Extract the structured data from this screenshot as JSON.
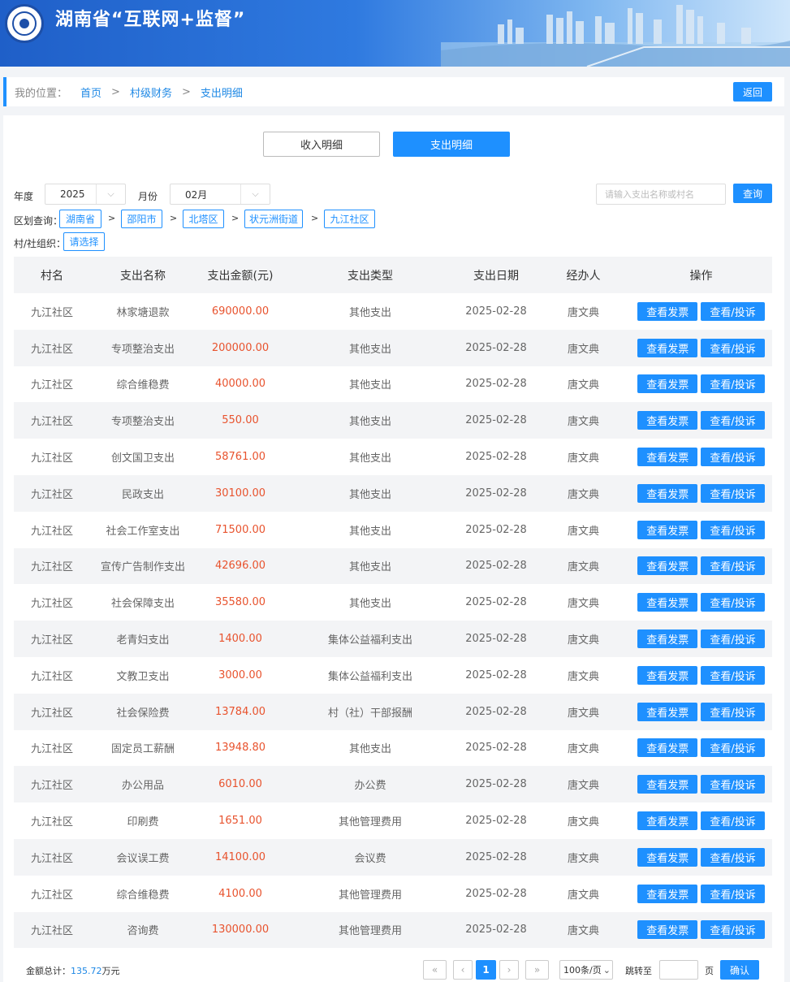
{
  "header": {
    "title": "湖南省“互联网+监督”",
    "logo_icon": "eye-seal-icon"
  },
  "breadcrumb": {
    "label": "我的位置：",
    "items": [
      "首页",
      "村级财务",
      "支出明细"
    ],
    "separator": ">",
    "back_label": "返回"
  },
  "tabs": {
    "income": "收入明细",
    "expense": "支出明细",
    "active": "expense"
  },
  "filters": {
    "year_label": "年度",
    "year_value": "2025",
    "month_label": "月份",
    "month_value": "02月",
    "search_placeholder": "请输入支出名称或村名",
    "search_button": "查询",
    "region_label": "区划查询：",
    "regions": [
      "湖南省",
      "邵阳市",
      "北塔区",
      "状元洲街道",
      "九江社区"
    ],
    "region_sep": ">",
    "org_label": "村/社组织：",
    "org_value": "请选择"
  },
  "table": {
    "headers": [
      "村名",
      "支出名称",
      "支出金额(元)",
      "支出类型",
      "支出日期",
      "经办人",
      "操作"
    ],
    "action_invoice": "查看发票",
    "action_complaint": "查看/投诉",
    "rows": [
      {
        "village": "九江社区",
        "name": "林家塘退款",
        "amount": "690000.00",
        "type": "其他支出",
        "date": "2025-02-28",
        "handler": "唐文典"
      },
      {
        "village": "九江社区",
        "name": "专项整治支出",
        "amount": "200000.00",
        "type": "其他支出",
        "date": "2025-02-28",
        "handler": "唐文典"
      },
      {
        "village": "九江社区",
        "name": "综合维稳费",
        "amount": "40000.00",
        "type": "其他支出",
        "date": "2025-02-28",
        "handler": "唐文典"
      },
      {
        "village": "九江社区",
        "name": "专项整治支出",
        "amount": "550.00",
        "type": "其他支出",
        "date": "2025-02-28",
        "handler": "唐文典"
      },
      {
        "village": "九江社区",
        "name": "创文国卫支出",
        "amount": "58761.00",
        "type": "其他支出",
        "date": "2025-02-28",
        "handler": "唐文典"
      },
      {
        "village": "九江社区",
        "name": "民政支出",
        "amount": "30100.00",
        "type": "其他支出",
        "date": "2025-02-28",
        "handler": "唐文典"
      },
      {
        "village": "九江社区",
        "name": "社会工作室支出",
        "amount": "71500.00",
        "type": "其他支出",
        "date": "2025-02-28",
        "handler": "唐文典"
      },
      {
        "village": "九江社区",
        "name": "宣传广告制作支出",
        "amount": "42696.00",
        "type": "其他支出",
        "date": "2025-02-28",
        "handler": "唐文典"
      },
      {
        "village": "九江社区",
        "name": "社会保障支出",
        "amount": "35580.00",
        "type": "其他支出",
        "date": "2025-02-28",
        "handler": "唐文典"
      },
      {
        "village": "九江社区",
        "name": "老青妇支出",
        "amount": "1400.00",
        "type": "集体公益福利支出",
        "date": "2025-02-28",
        "handler": "唐文典"
      },
      {
        "village": "九江社区",
        "name": "文教卫支出",
        "amount": "3000.00",
        "type": "集体公益福利支出",
        "date": "2025-02-28",
        "handler": "唐文典"
      },
      {
        "village": "九江社区",
        "name": "社会保险费",
        "amount": "13784.00",
        "type": "村（社）干部报酬",
        "date": "2025-02-28",
        "handler": "唐文典"
      },
      {
        "village": "九江社区",
        "name": "固定员工薪酬",
        "amount": "13948.80",
        "type": "其他支出",
        "date": "2025-02-28",
        "handler": "唐文典"
      },
      {
        "village": "九江社区",
        "name": "办公用品",
        "amount": "6010.00",
        "type": "办公费",
        "date": "2025-02-28",
        "handler": "唐文典"
      },
      {
        "village": "九江社区",
        "name": "印刷费",
        "amount": "1651.00",
        "type": "其他管理费用",
        "date": "2025-02-28",
        "handler": "唐文典"
      },
      {
        "village": "九江社区",
        "name": "会议误工费",
        "amount": "14100.00",
        "type": "会议费",
        "date": "2025-02-28",
        "handler": "唐文典"
      },
      {
        "village": "九江社区",
        "name": "综合维稳费",
        "amount": "4100.00",
        "type": "其他管理费用",
        "date": "2025-02-28",
        "handler": "唐文典"
      },
      {
        "village": "九江社区",
        "name": "咨询费",
        "amount": "130000.00",
        "type": "其他管理费用",
        "date": "2025-02-28",
        "handler": "唐文典"
      }
    ]
  },
  "footer": {
    "total_label": "金额总计：",
    "total_value": "135.72",
    "total_unit": "万元",
    "first_icon": "«",
    "prev_icon": "‹",
    "current_page": "1",
    "next_icon": "›",
    "last_icon": "»",
    "page_size": "100条/页",
    "jump_label": "跳转至",
    "page_unit": "页",
    "confirm": "确认"
  },
  "colors": {
    "primary": "#1e90ff",
    "amount": "#e8532e"
  }
}
